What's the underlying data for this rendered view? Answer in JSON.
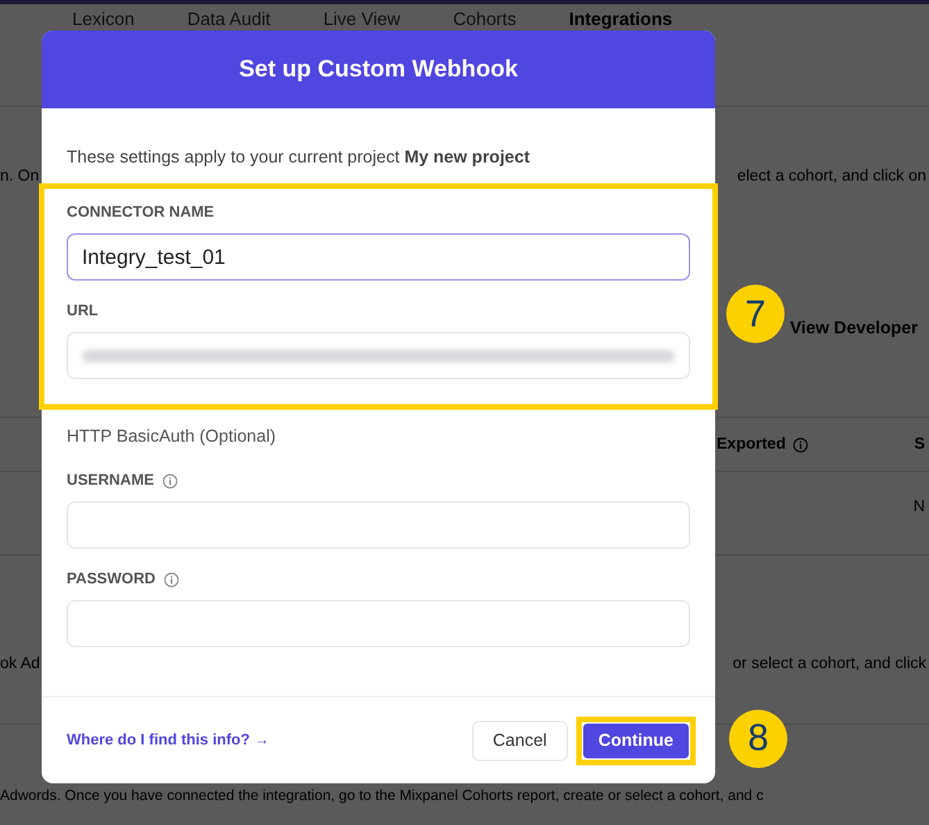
{
  "background": {
    "tabs": [
      {
        "label": "Lexicon",
        "selected": false
      },
      {
        "label": "Data Audit",
        "selected": false
      },
      {
        "label": "Live View",
        "selected": false
      },
      {
        "label": "Cohorts",
        "selected": false
      },
      {
        "label": "Integrations",
        "selected": true
      }
    ],
    "row_1_left": "n. On",
    "row_1_right": "elect a cohort, and click on",
    "link": "View Developer",
    "column_1": "Exported",
    "column_2": "S",
    "cell": "N",
    "row_2_left": "ok Ad",
    "row_2_right": "or select a cohort, and click",
    "row_3": "Adwords. Once you have connected the integration, go to the Mixpanel Cohorts report, create or select a cohort, and c"
  },
  "dialog": {
    "title": "Set up Custom Webhook",
    "intro": "These settings apply to your current project **My new project**",
    "highlight_badge": "7",
    "highlighted_fields": [
      {
        "label": "CONNECTOR NAME",
        "value": "Integry_test_01",
        "info": false,
        "focused": true,
        "blurred": false
      },
      {
        "label": "URL",
        "info": false,
        "focused": false,
        "blurred": true
      }
    ],
    "section_label": "HTTP BasicAuth (Optional)",
    "fields": [
      {
        "label": "USERNAME",
        "info": true,
        "focused": false,
        "blurred": false
      },
      {
        "label": "PASSWORD",
        "info": true,
        "focused": false,
        "blurred": false
      }
    ],
    "help_link": "Where do I find this info? →",
    "buttons": [
      {
        "label": "Cancel",
        "kind": "secondary",
        "highlighted": false
      },
      {
        "label": "Continue",
        "kind": "primary",
        "highlighted": true,
        "badge": "8"
      }
    ]
  }
}
